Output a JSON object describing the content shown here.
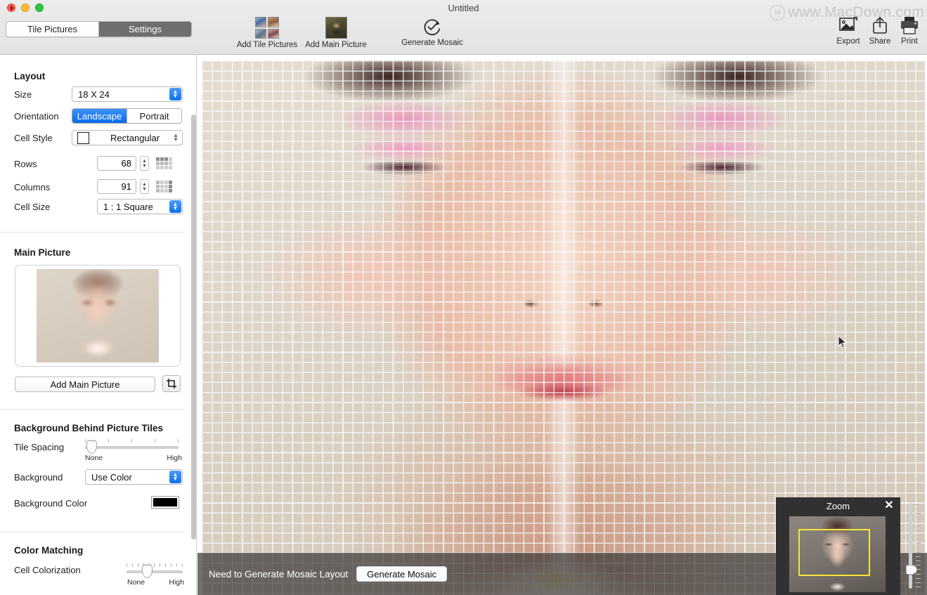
{
  "window": {
    "title": "Untitled",
    "traffic_lights": [
      "close-red",
      "minimize-yellow",
      "zoom-green"
    ]
  },
  "view_switcher": {
    "tabs": [
      {
        "label": "Tile Pictures",
        "active": false
      },
      {
        "label": "Settings",
        "active": true
      }
    ]
  },
  "toolbar": {
    "add_tile_pictures": "Add Tile Pictures",
    "add_main_picture": "Add Main Picture",
    "generate_mosaic": "Generate Mosaic",
    "export": "Export",
    "share": "Share",
    "print": "Print",
    "watermark": "www.MacDown.com"
  },
  "sidebar": {
    "layout": {
      "heading": "Layout",
      "size_label": "Size",
      "size_value": "18 X 24",
      "orientation_label": "Orientation",
      "orientation_options": [
        "Landscape",
        "Portrait"
      ],
      "orientation_selected": "Landscape",
      "cell_style_label": "Cell Style",
      "cell_style_value": "Rectangular",
      "rows_label": "Rows",
      "rows_value": "68",
      "columns_label": "Columns",
      "columns_value": "91",
      "cell_size_label": "Cell Size",
      "cell_size_value": "1 : 1 Square"
    },
    "main_picture": {
      "heading": "Main Picture",
      "add_button": "Add Main Picture",
      "crop_icon": "crop-icon"
    },
    "background": {
      "heading": "Background Behind Picture Tiles",
      "tile_spacing_label": "Tile Spacing",
      "tile_spacing_min": "None",
      "tile_spacing_max": "High",
      "tile_spacing_percent": 2,
      "background_label": "Background",
      "background_value": "Use Color",
      "background_color_label": "Background Color",
      "background_color_value": "#000000"
    },
    "color_matching": {
      "heading": "Color Matching",
      "cell_colorization_label": "Cell Colorization",
      "cell_colorization_min": "None",
      "cell_colorization_max": "High",
      "cell_colorization_percent": 33
    }
  },
  "status": {
    "message": "Need to Generate Mosaic Layout",
    "button": "Generate Mosaic"
  },
  "zoom_panel": {
    "title": "Zoom",
    "close_icon": "close-icon",
    "selection_color": "#f7e53a"
  }
}
